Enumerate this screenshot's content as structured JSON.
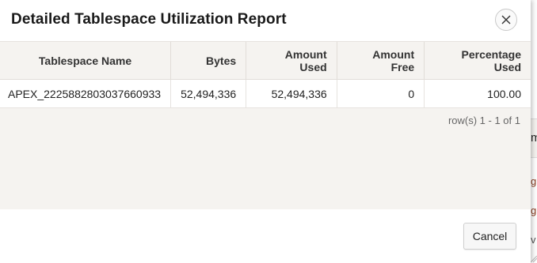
{
  "dialog": {
    "title": "Detailed Tablespace Utilization Report",
    "close_icon": "close-icon"
  },
  "report": {
    "columns": [
      "Tablespace Name",
      "Bytes",
      "Amount Used",
      "Amount Free",
      "Percentage Used"
    ],
    "rows": [
      [
        "APEX_2225882803037660933",
        "52,494,336",
        "52,494,336",
        "0",
        "100.00"
      ]
    ],
    "pagination": "row(s) 1 - 1 of 1"
  },
  "footer": {
    "cancel_label": "Cancel"
  },
  "background_page": {
    "fragments": [
      "m",
      "g",
      "g",
      "v"
    ]
  }
}
